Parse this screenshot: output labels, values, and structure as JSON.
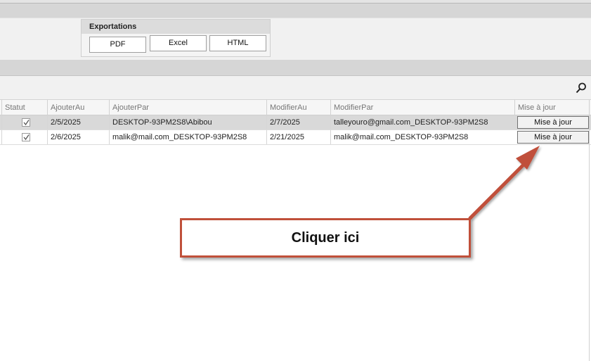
{
  "exportations": {
    "title": "Exportations",
    "buttons": {
      "pdf": "PDF",
      "excel": "Excel",
      "html": "HTML"
    }
  },
  "grid": {
    "columns": [
      "Statut",
      "AjouterAu",
      "AjouterPar",
      "ModifierAu",
      "ModifierPar",
      "Mise à jour"
    ],
    "rows": [
      {
        "statut": true,
        "ajouterAu": "2/5/2025",
        "ajouterPar": "DESKTOP-93PM2S8\\Abibou",
        "modifierAu": "2/7/2025",
        "modifierPar": "talleyouro@gmail.com_DESKTOP-93PM2S8",
        "button": "Mise à jour"
      },
      {
        "statut": true,
        "ajouterAu": "2/6/2025",
        "ajouterPar": "malik@mail.com_DESKTOP-93PM2S8",
        "modifierAu": "2/21/2025",
        "modifierPar": "malik@mail.com_DESKTOP-93PM2S8",
        "button": "Mise à jour"
      }
    ]
  },
  "callout": {
    "text": "Cliquer ici"
  },
  "icons": {
    "search": "search-icon",
    "checkbox": "check-icon"
  },
  "colors": {
    "callout_border": "#c0503a",
    "selected_row": "#d9d9d9"
  }
}
